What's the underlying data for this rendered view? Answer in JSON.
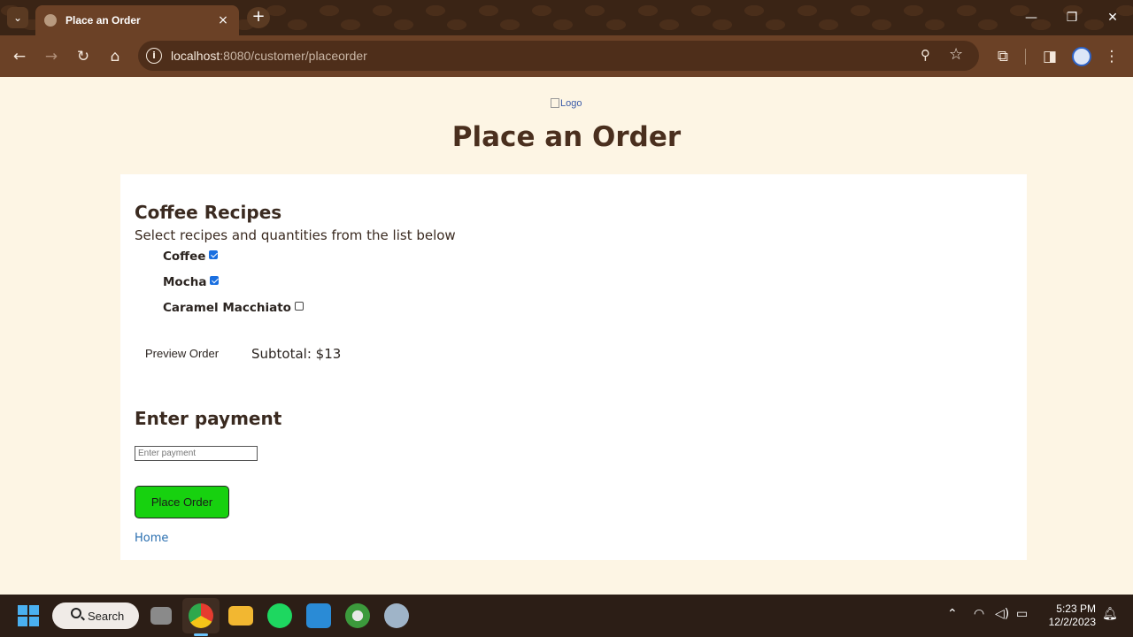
{
  "browser": {
    "tab_title": "Place an Order",
    "tab_close_icon": "×",
    "new_tab_icon": "+",
    "url_host": "localhost",
    "url_rest": ":8080/customer/placeorder"
  },
  "page": {
    "logo_alt": "Logo",
    "title": "Place an Order"
  },
  "recipes": {
    "heading": "Coffee Recipes",
    "instructions": "Select recipes and quantities from the list below",
    "items": [
      {
        "label": "Coffee",
        "checked": true
      },
      {
        "label": "Mocha",
        "checked": true
      },
      {
        "label": "Caramel Macchiato",
        "checked": false
      }
    ],
    "preview_label": "Preview Order",
    "subtotal": "Subtotal: $13"
  },
  "payment": {
    "heading": "Enter payment",
    "placeholder": "Enter payment",
    "submit_label": "Place Order",
    "home_link": "Home"
  },
  "taskbar": {
    "search_label": "Search",
    "time": "5:23 PM",
    "date": "12/2/2023"
  },
  "colors": {
    "page_bg": "#fdf5e4",
    "title_color": "#4a2f1e",
    "place_order_bg": "#17d10f",
    "link": "#2a6fb0",
    "chrome_frame": "#6b4126"
  }
}
